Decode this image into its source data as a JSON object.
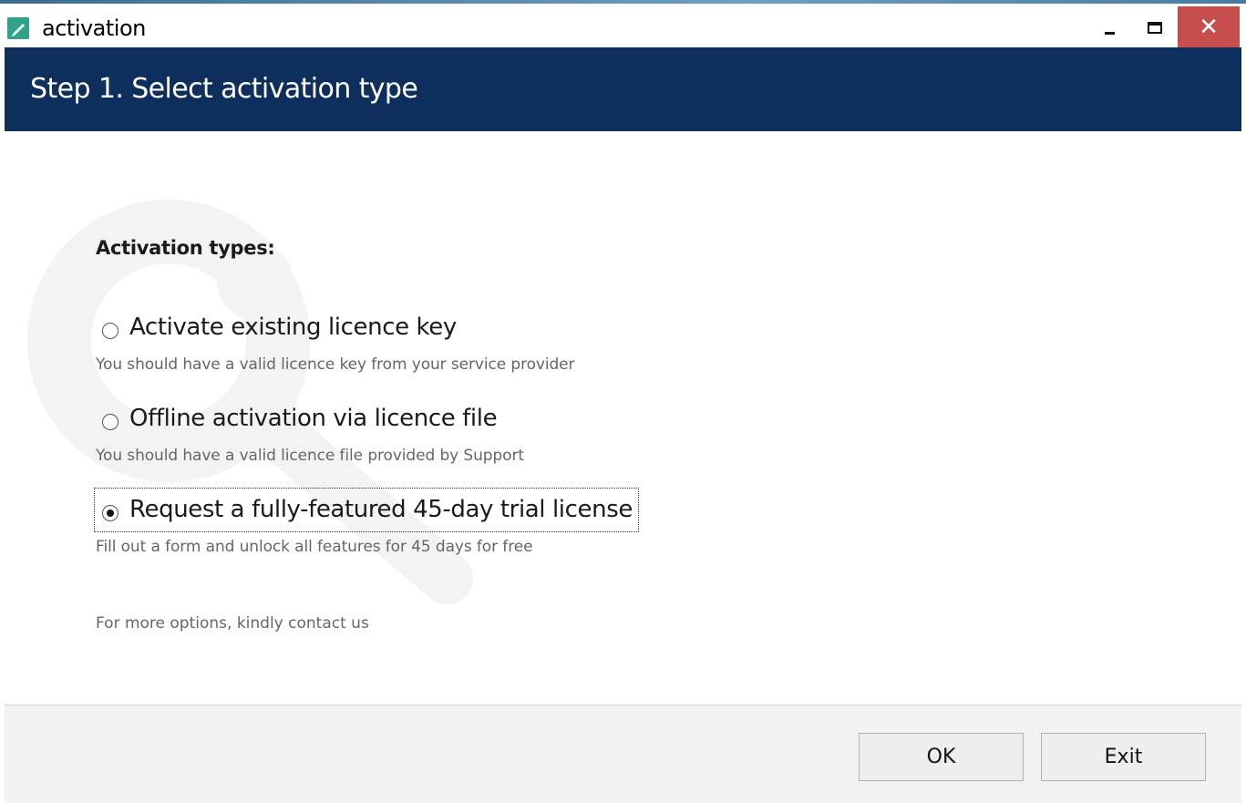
{
  "window": {
    "title": "activation",
    "controls": {
      "minimize_icon": "minimize-icon",
      "maximize_icon": "maximize-icon",
      "close_glyph": "✕"
    }
  },
  "header": {
    "title": "Step 1. Select activation type",
    "background_color": "#0e2f5e"
  },
  "main": {
    "heading": "Activation types:",
    "options": [
      {
        "label": "Activate existing licence key",
        "description": "You should have a valid licence key from your service provider",
        "selected": false
      },
      {
        "label": "Offline activation via licence file",
        "description": "You should have a valid licence file provided by Support",
        "selected": false
      },
      {
        "label": "Request a fully-featured 45-day trial license",
        "description": "Fill out a form and unlock all features for 45 days for free",
        "selected": true
      }
    ],
    "contact_text": "For more options, kindly contact us"
  },
  "footer": {
    "ok_label": "OK",
    "exit_label": "Exit"
  },
  "colors": {
    "close_button": "#c84d4d",
    "app_icon": "#2fa38a"
  }
}
